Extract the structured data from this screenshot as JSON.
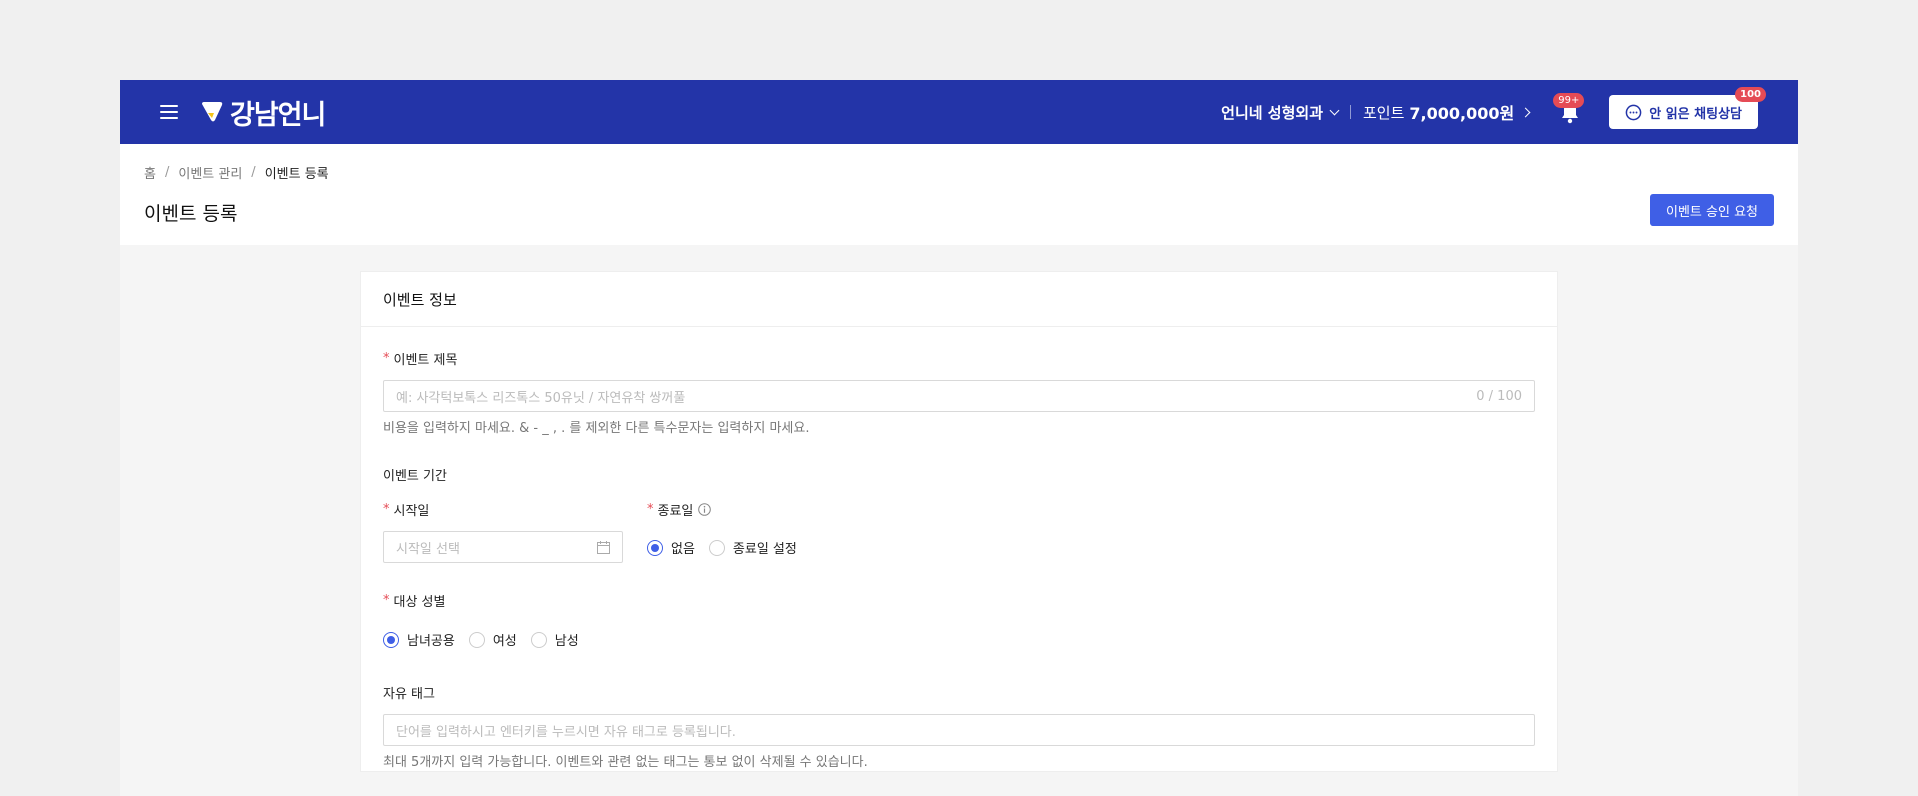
{
  "topbar": {
    "logo": "강남언니",
    "clinic": "언니네 성형외과",
    "points_label": "포인트",
    "points_value": "7,000,000원",
    "bell_badge": "99+",
    "chat_label": "안 읽은 채팅상담",
    "chat_badge": "100"
  },
  "breadcrumb": [
    "홈",
    "이벤트 관리",
    "이벤트 등록"
  ],
  "page_title": "이벤트 등록",
  "primary_button": "이벤트 승인 요청",
  "card": {
    "title": "이벤트 정보",
    "event_title": {
      "label": "이벤트 제목",
      "placeholder": "예: 사각턱보톡스 리즈톡스 50유닛 / 자연유착 쌍꺼풀",
      "counter": "0 / 100",
      "help": "비용을 입력하지 마세요. & - _ , . 를 제외한 다른 특수문자는 입력하지 마세요."
    },
    "period": {
      "label": "이벤트 기간",
      "start_label": "시작일",
      "start_placeholder": "시작일 선택",
      "end_label": "종료일",
      "end_options": [
        "없음",
        "종료일 설정"
      ],
      "end_selected": "없음"
    },
    "gender": {
      "label": "대상 성별",
      "options": [
        "남녀공용",
        "여성",
        "남성"
      ],
      "selected": "남녀공용"
    },
    "tags": {
      "label": "자유 태그",
      "placeholder": "단어를 입력하시고 엔터키를 누르시면 자유 태그로 등록됩니다.",
      "help": "최대 5개까지 입력 가능합니다. 이벤트와 관련 없는 태그는 통보 없이 삭제될 수 있습니다."
    }
  },
  "colors": {
    "topbar": "#2334a8",
    "primary": "#3f5fe6",
    "required": "#e54b55",
    "badge": "#e54b55"
  },
  "icons": [
    "menu-icon",
    "logo-icon",
    "chevron-down-icon",
    "chevron-right-icon",
    "bell-icon",
    "chat-icon",
    "calendar-icon",
    "info-icon"
  ]
}
